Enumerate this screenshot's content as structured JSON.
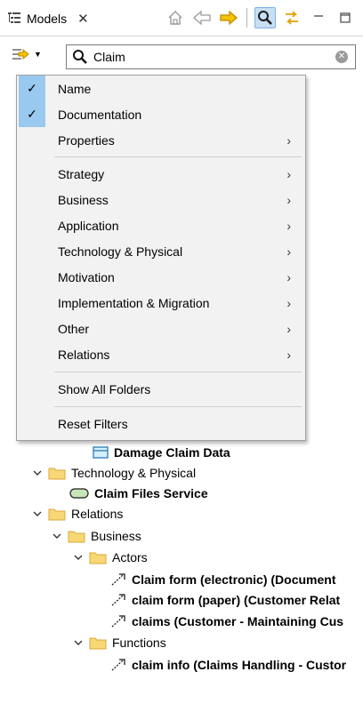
{
  "tab": {
    "title": "Models",
    "close_glyph": "✕"
  },
  "toolbar": {
    "icons": [
      "home-icon",
      "back-arrow-icon",
      "forward-arrow-icon",
      "search-icon",
      "link-icon",
      "minimize-icon",
      "maximize-icon"
    ]
  },
  "search": {
    "value": "Claim"
  },
  "menu": {
    "items": [
      {
        "label": "Name",
        "checked": true,
        "submenu": false
      },
      {
        "label": "Documentation",
        "checked": true,
        "submenu": false
      },
      {
        "label": "Properties",
        "checked": false,
        "submenu": true
      },
      {
        "label": "Strategy",
        "checked": false,
        "submenu": true
      },
      {
        "label": "Business",
        "checked": false,
        "submenu": true
      },
      {
        "label": "Application",
        "checked": false,
        "submenu": true
      },
      {
        "label": "Technology & Physical",
        "checked": false,
        "submenu": true
      },
      {
        "label": "Motivation",
        "checked": false,
        "submenu": true
      },
      {
        "label": "Implementation & Migration",
        "checked": false,
        "submenu": true
      },
      {
        "label": "Other",
        "checked": false,
        "submenu": true
      },
      {
        "label": "Relations",
        "checked": false,
        "submenu": true
      },
      {
        "label": "Show All Folders",
        "checked": false,
        "submenu": false
      },
      {
        "label": "Reset Filters",
        "checked": false,
        "submenu": false
      }
    ],
    "check_glyph": "✓",
    "arrow_glyph": "›"
  },
  "tree": {
    "items": [
      {
        "label": "Damage Claim Data"
      },
      {
        "label": "Technology & Physical"
      },
      {
        "label": "Claim Files Service"
      },
      {
        "label": "Relations"
      },
      {
        "label": "Business"
      },
      {
        "label": "Actors"
      },
      {
        "label": "Claim form (electronic) (Document"
      },
      {
        "label": "claim form (paper) (Customer Relat"
      },
      {
        "label": "claims (Customer - Maintaining Cus"
      },
      {
        "label": "Functions"
      },
      {
        "label": "claim info (Claims Handling - Custor"
      }
    ]
  },
  "colors": {
    "folder": "#f8d775",
    "folder_edge": "#d9a93a",
    "menu_check_bg": "#99c9ef",
    "toolbar_active": "#c7def3",
    "arrow_yellow": "#f5c300"
  }
}
